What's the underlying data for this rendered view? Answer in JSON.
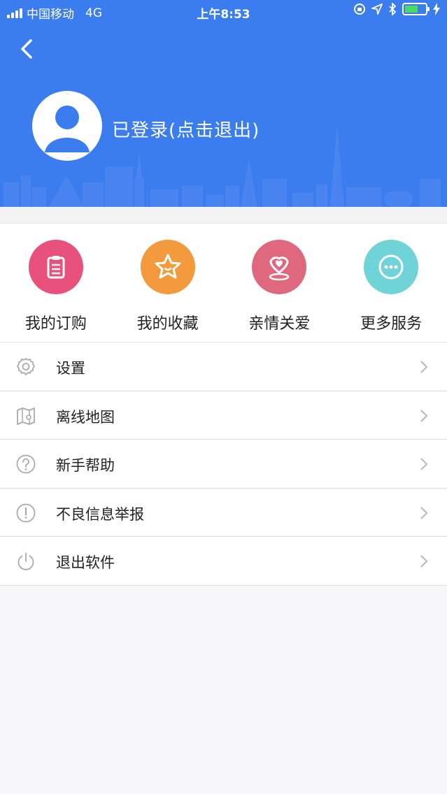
{
  "status_bar": {
    "carrier": "中国移动",
    "network": "4G",
    "time": "上午8:53"
  },
  "colors": {
    "header_bg": "#3b7cef",
    "skyline": "#4a84f0",
    "battery_fill": "#4cd964"
  },
  "profile": {
    "login_text": "已登录(点击退出)"
  },
  "quick_actions": [
    {
      "label": "我的订购",
      "icon": "clipboard-icon",
      "color": "#e8517b"
    },
    {
      "label": "我的收藏",
      "icon": "star-icon",
      "color": "#f29a3c"
    },
    {
      "label": "亲情关爱",
      "icon": "heart-location-icon",
      "color": "#e0687e"
    },
    {
      "label": "更多服务",
      "icon": "more-dots-icon",
      "color": "#6fd3d8"
    }
  ],
  "menu": [
    {
      "label": "设置",
      "icon": "gear-icon"
    },
    {
      "label": "离线地图",
      "icon": "map-icon"
    },
    {
      "label": "新手帮助",
      "icon": "help-icon"
    },
    {
      "label": "不良信息举报",
      "icon": "warning-icon"
    },
    {
      "label": "退出软件",
      "icon": "power-icon"
    }
  ]
}
